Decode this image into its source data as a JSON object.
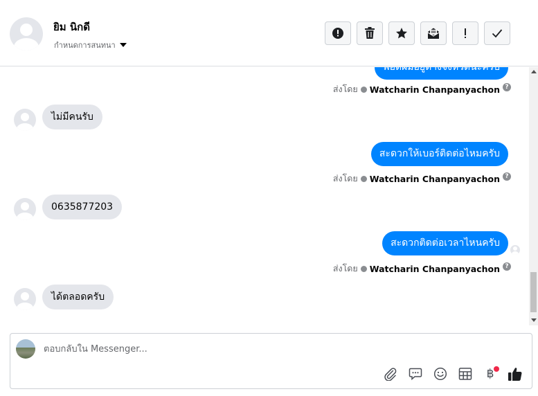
{
  "header": {
    "contact_name": "ยิม นิกดี",
    "assign_label": "กำหนดการสนทนา",
    "toolbar": [
      {
        "name": "spam-button",
        "icon": "alert-circle-icon"
      },
      {
        "name": "delete-button",
        "icon": "trash-icon"
      },
      {
        "name": "star-button",
        "icon": "star-icon"
      },
      {
        "name": "mark-unread-button",
        "icon": "envelope-open-icon"
      },
      {
        "name": "follow-up-button",
        "icon": "exclamation-icon"
      },
      {
        "name": "mark-done-button",
        "icon": "check-icon"
      }
    ]
  },
  "thread": {
    "partial_top_message": "พอดีผมอยู่ต่างจังหวัดน่ะครับ",
    "messages": [
      {
        "direction": "in",
        "text": "ไม่มีคนรับ"
      },
      {
        "direction": "out",
        "text": "สะดวกให้เบอร์ติดต่อไหมครับ"
      },
      {
        "direction": "in",
        "text": "0635877203"
      },
      {
        "direction": "out",
        "text": "สะดวกติดต่อเวลาไหนครับ"
      },
      {
        "direction": "in",
        "text": "ได้ตลอดครับ"
      }
    ],
    "sent_by_label": "ส่งโดย",
    "sender_name": "Watcharin Chanpanyachon",
    "help_glyph": "?"
  },
  "composer": {
    "placeholder": "ตอบกลับใน Messenger...",
    "value": "",
    "baht_glyph": "฿",
    "tools": [
      "paperclip-icon",
      "saved-reply-icon",
      "emoji-icon",
      "table-icon",
      "baht-payment-icon",
      "thumbs-up-icon"
    ]
  },
  "colors": {
    "brand_blue": "#0084ff",
    "incoming_bubble": "#e4e6eb",
    "notification_dot": "#f02849"
  }
}
